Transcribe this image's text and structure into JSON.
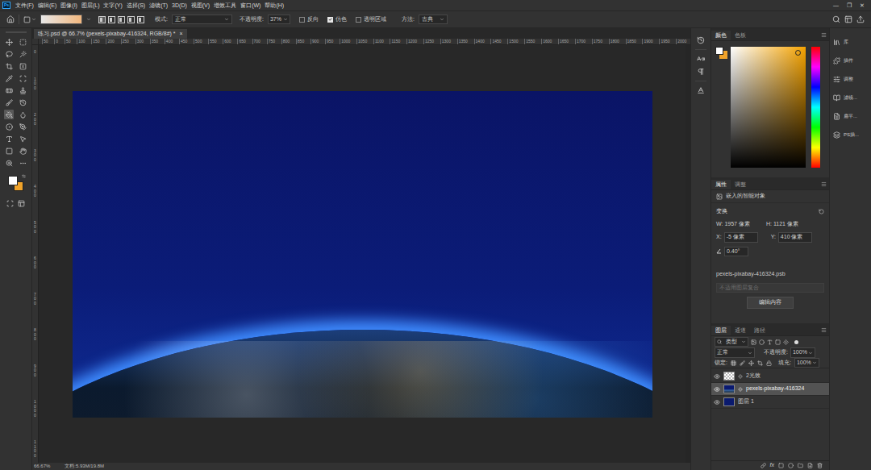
{
  "app": {
    "logo": "Ps"
  },
  "menu": [
    "文件(F)",
    "编辑(E)",
    "图像(I)",
    "图层(L)",
    "文字(Y)",
    "选择(S)",
    "滤镜(T)",
    "3D(D)",
    "视图(V)",
    "增效工具",
    "窗口(W)",
    "帮助(H)"
  ],
  "window_controls": [
    "—",
    "❐",
    "✕"
  ],
  "tools": [
    {
      "selected": false
    },
    {
      "selected": false
    },
    {
      "selected": false
    },
    {
      "selected": false
    },
    {
      "selected": false
    },
    {
      "selected": false
    },
    {
      "selected": false
    },
    {
      "selected": false
    },
    {
      "selected": false
    },
    {
      "selected": false
    },
    {
      "selected": false
    },
    {
      "selected": false
    },
    {
      "selected": true
    },
    {
      "selected": false
    },
    {
      "selected": false
    },
    {
      "selected": false
    },
    {
      "selected": false
    },
    {
      "selected": false
    },
    {
      "selected": false
    },
    {
      "selected": false
    },
    {
      "selected": false
    },
    {
      "selected": false
    }
  ],
  "options_bar": {
    "mode_label": "模式:",
    "mode": "正常",
    "opacity_label": "不透明度:",
    "opacity": "37%",
    "checkboxes": [
      {
        "label": "反向",
        "checked": false
      },
      {
        "label": "仿色",
        "checked": true
      },
      {
        "label": "透明区域",
        "checked": false
      }
    ],
    "method_label": "方法:",
    "method": "古典"
  },
  "document": {
    "tab": "练习.psd @ 66.7% (pexels-pixabay-416324, RGB/8#) *",
    "close": "×",
    "ruler_top": [
      "50",
      "0",
      "50",
      "100",
      "150",
      "200",
      "250",
      "300",
      "350",
      "400",
      "450",
      "500",
      "550",
      "600",
      "650",
      "700",
      "750",
      "800",
      "850",
      "900",
      "950",
      "1000",
      "1050",
      "1100",
      "1150",
      "1200",
      "1250",
      "1300",
      "1350",
      "1400",
      "1450",
      "1500",
      "1550",
      "1600",
      "1650",
      "1700",
      "1750",
      "1800",
      "1850",
      "1900",
      "1950",
      "2000"
    ],
    "ruler_left": [
      "0",
      "100",
      "200",
      "300",
      "400",
      "500",
      "600",
      "700",
      "800",
      "900",
      "1000",
      "1100"
    ]
  },
  "color_panel": {
    "tabs": [
      {
        "label": "颜色",
        "selected": true
      },
      {
        "label": "色板",
        "selected": false
      }
    ]
  },
  "properties": {
    "tabs": [
      {
        "label": "属性",
        "selected": true
      },
      {
        "label": "调整",
        "selected": false
      }
    ],
    "type": "嵌入的智能对象",
    "section": "变换",
    "w_label": "W:",
    "w": "1957 像素",
    "h_label": "H:",
    "h": "1121 像素",
    "x_label": "X:",
    "x": "-5 像素",
    "y_label": "Y:",
    "y": "410 像素",
    "angle": "0.40°",
    "file": "pexels-pixabay-416324.psb",
    "comp_placeholder": "不适用图层复合",
    "edit_button": "编辑内容"
  },
  "layers_panel": {
    "tabs": [
      {
        "label": "图层",
        "selected": true
      },
      {
        "label": "通道",
        "selected": false
      },
      {
        "label": "路径",
        "selected": false
      }
    ],
    "filter": "类型",
    "blend": "正常",
    "opacity_label": "不透明度:",
    "opacity": "100%",
    "lock_label": "锁定:",
    "fill_label": "填充:",
    "fill": "100%",
    "layers": [
      {
        "name": "2光效",
        "visible": true,
        "selected": false,
        "kind": "transparent"
      },
      {
        "name": "pexels-pixabay-416324",
        "visible": true,
        "selected": true,
        "kind": "photo"
      },
      {
        "name": "图层 1",
        "visible": true,
        "selected": false,
        "kind": "fill"
      }
    ],
    "fx": "fx"
  },
  "side_panels": [
    "库",
    "插件",
    "调整",
    "滤镜...",
    "扁平...",
    "PS插..."
  ],
  "status_bar": {
    "zoom": "66.67%",
    "doc": "文档:5.93M/19.8M"
  }
}
